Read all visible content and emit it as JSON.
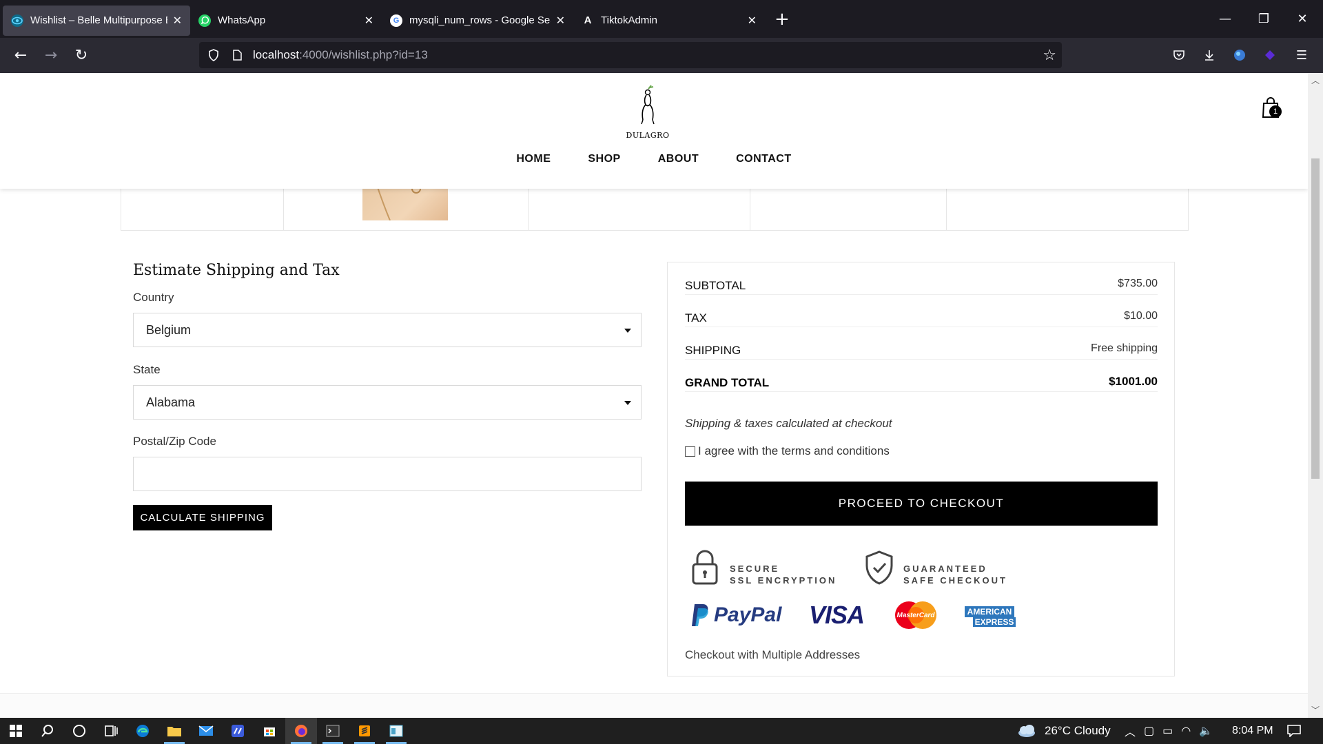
{
  "browser": {
    "tabs": [
      {
        "title": "Wishlist – Belle Multipurpose B",
        "icon": "eye-favicon",
        "active": true
      },
      {
        "title": "WhatsApp",
        "icon": "whatsapp-favicon",
        "active": false
      },
      {
        "title": "mysqli_num_rows - Google Sea",
        "icon": "google-favicon",
        "active": false
      },
      {
        "title": "TiktokAdmin",
        "icon": "a-favicon",
        "active": false
      }
    ],
    "url_host": "localhost",
    "url_rest": ":4000/wishlist.php?id=13"
  },
  "site": {
    "logo_text": "DULAGRO",
    "nav": [
      "HOME",
      "SHOP",
      "ABOUT",
      "CONTACT"
    ],
    "cart_count": "1"
  },
  "shipping": {
    "title": "Estimate Shipping and Tax",
    "country_label": "Country",
    "country_value": "Belgium",
    "state_label": "State",
    "state_value": "Alabama",
    "zip_label": "Postal/Zip Code",
    "zip_value": "",
    "button": "CALCULATE SHIPPING"
  },
  "totals": {
    "rows": [
      {
        "label": "SUBTOTAL",
        "value": "$735.00"
      },
      {
        "label": "TAX",
        "value": "$10.00"
      },
      {
        "label": "SHIPPING",
        "value": "Free shipping"
      },
      {
        "label": "GRAND TOTAL",
        "value": "$1001.00"
      }
    ],
    "note": "Shipping & taxes calculated at checkout",
    "agree": "I agree with the terms and conditions",
    "checkout_button": "PROCEED TO CHECKOUT",
    "badge1_line1": "SECURE",
    "badge1_line2": "SSL ENCRYPTION",
    "badge2_line1": "GUARANTEED",
    "badge2_line2": "SAFE CHECKOUT",
    "payment_logos": {
      "paypal": "PayPal",
      "visa": "VISA",
      "mastercard": "MasterCard",
      "amex_line1": "AMERICAN",
      "amex_line2": "EXPRESS"
    },
    "multi_address": "Checkout with Multiple Addresses"
  },
  "taskbar": {
    "weather": "26°C  Cloudy",
    "time": "8:04 PM"
  },
  "colors": {
    "tab_bar": "#1c1b22",
    "nav_bar": "#2b2a33",
    "button_black": "#000000",
    "paypal_blue": "#253b80",
    "visa_navy": "#1a1f71"
  }
}
